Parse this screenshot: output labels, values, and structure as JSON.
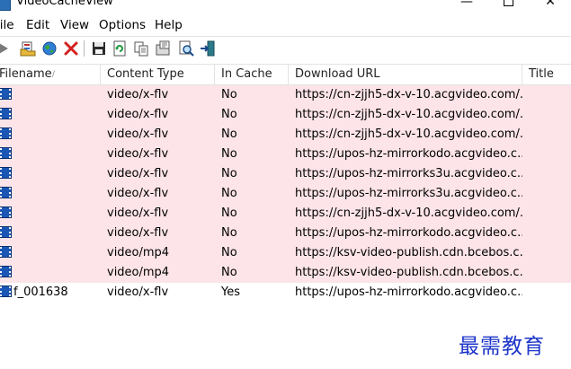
{
  "window": {
    "title": "VideoCacheView",
    "minimize_glyph": "—",
    "close_glyph": "✕"
  },
  "menu": {
    "items": [
      "File",
      "Edit",
      "View",
      "Options",
      "Help"
    ]
  },
  "toolbar": {
    "buttons": [
      {
        "icon": "play-icon"
      },
      {
        "icon": "open-folder-icon"
      },
      {
        "icon": "globe-icon"
      },
      {
        "icon": "delete-x-icon"
      },
      {
        "icon": "save-icon"
      },
      {
        "icon": "refresh-icon"
      },
      {
        "icon": "copy-icon"
      },
      {
        "icon": "properties-icon"
      },
      {
        "icon": "find-icon"
      },
      {
        "icon": "exit-icon"
      }
    ]
  },
  "table": {
    "columns": [
      "Filename",
      "Content Type",
      "In Cache",
      "Download URL",
      "Title"
    ],
    "sort_indicator": "/",
    "rows": [
      {
        "filename": "",
        "content_type": "video/x-flv",
        "in_cache": "No",
        "url": "https://cn-zjjh5-dx-v-10.acgvideo.com/...",
        "title": ""
      },
      {
        "filename": "",
        "content_type": "video/x-flv",
        "in_cache": "No",
        "url": "https://cn-zjjh5-dx-v-10.acgvideo.com/...",
        "title": ""
      },
      {
        "filename": "",
        "content_type": "video/x-flv",
        "in_cache": "No",
        "url": "https://cn-zjjh5-dx-v-10.acgvideo.com/...",
        "title": ""
      },
      {
        "filename": "",
        "content_type": "video/x-flv",
        "in_cache": "No",
        "url": "https://upos-hz-mirrorkodo.acgvideo.c...",
        "title": ""
      },
      {
        "filename": "",
        "content_type": "video/x-flv",
        "in_cache": "No",
        "url": "https://upos-hz-mirrorks3u.acgvideo.c...",
        "title": ""
      },
      {
        "filename": "",
        "content_type": "video/x-flv",
        "in_cache": "No",
        "url": "https://upos-hz-mirrorks3u.acgvideo.c...",
        "title": ""
      },
      {
        "filename": "",
        "content_type": "video/x-flv",
        "in_cache": "No",
        "url": "https://cn-zjjh5-dx-v-10.acgvideo.com/...",
        "title": ""
      },
      {
        "filename": "",
        "content_type": "video/x-flv",
        "in_cache": "No",
        "url": "https://upos-hz-mirrorkodo.acgvideo.c...",
        "title": ""
      },
      {
        "filename": "",
        "content_type": "video/mp4",
        "in_cache": "No",
        "url": "https://ksv-video-publish.cdn.bcebos.c...",
        "title": ""
      },
      {
        "filename": "",
        "content_type": "video/mp4",
        "in_cache": "No",
        "url": "https://ksv-video-publish.cdn.bcebos.c...",
        "title": ""
      },
      {
        "filename": "f_001638",
        "content_type": "video/x-flv",
        "in_cache": "Yes",
        "url": "https://upos-hz-mirrorkodo.acgvideo.c...",
        "title": ""
      }
    ],
    "colors": {
      "highlight_row": "#fce4e8",
      "film_icon": "#1b56b4"
    }
  },
  "watermark": {
    "text": "最需教育",
    "color": "#1d35c9"
  }
}
